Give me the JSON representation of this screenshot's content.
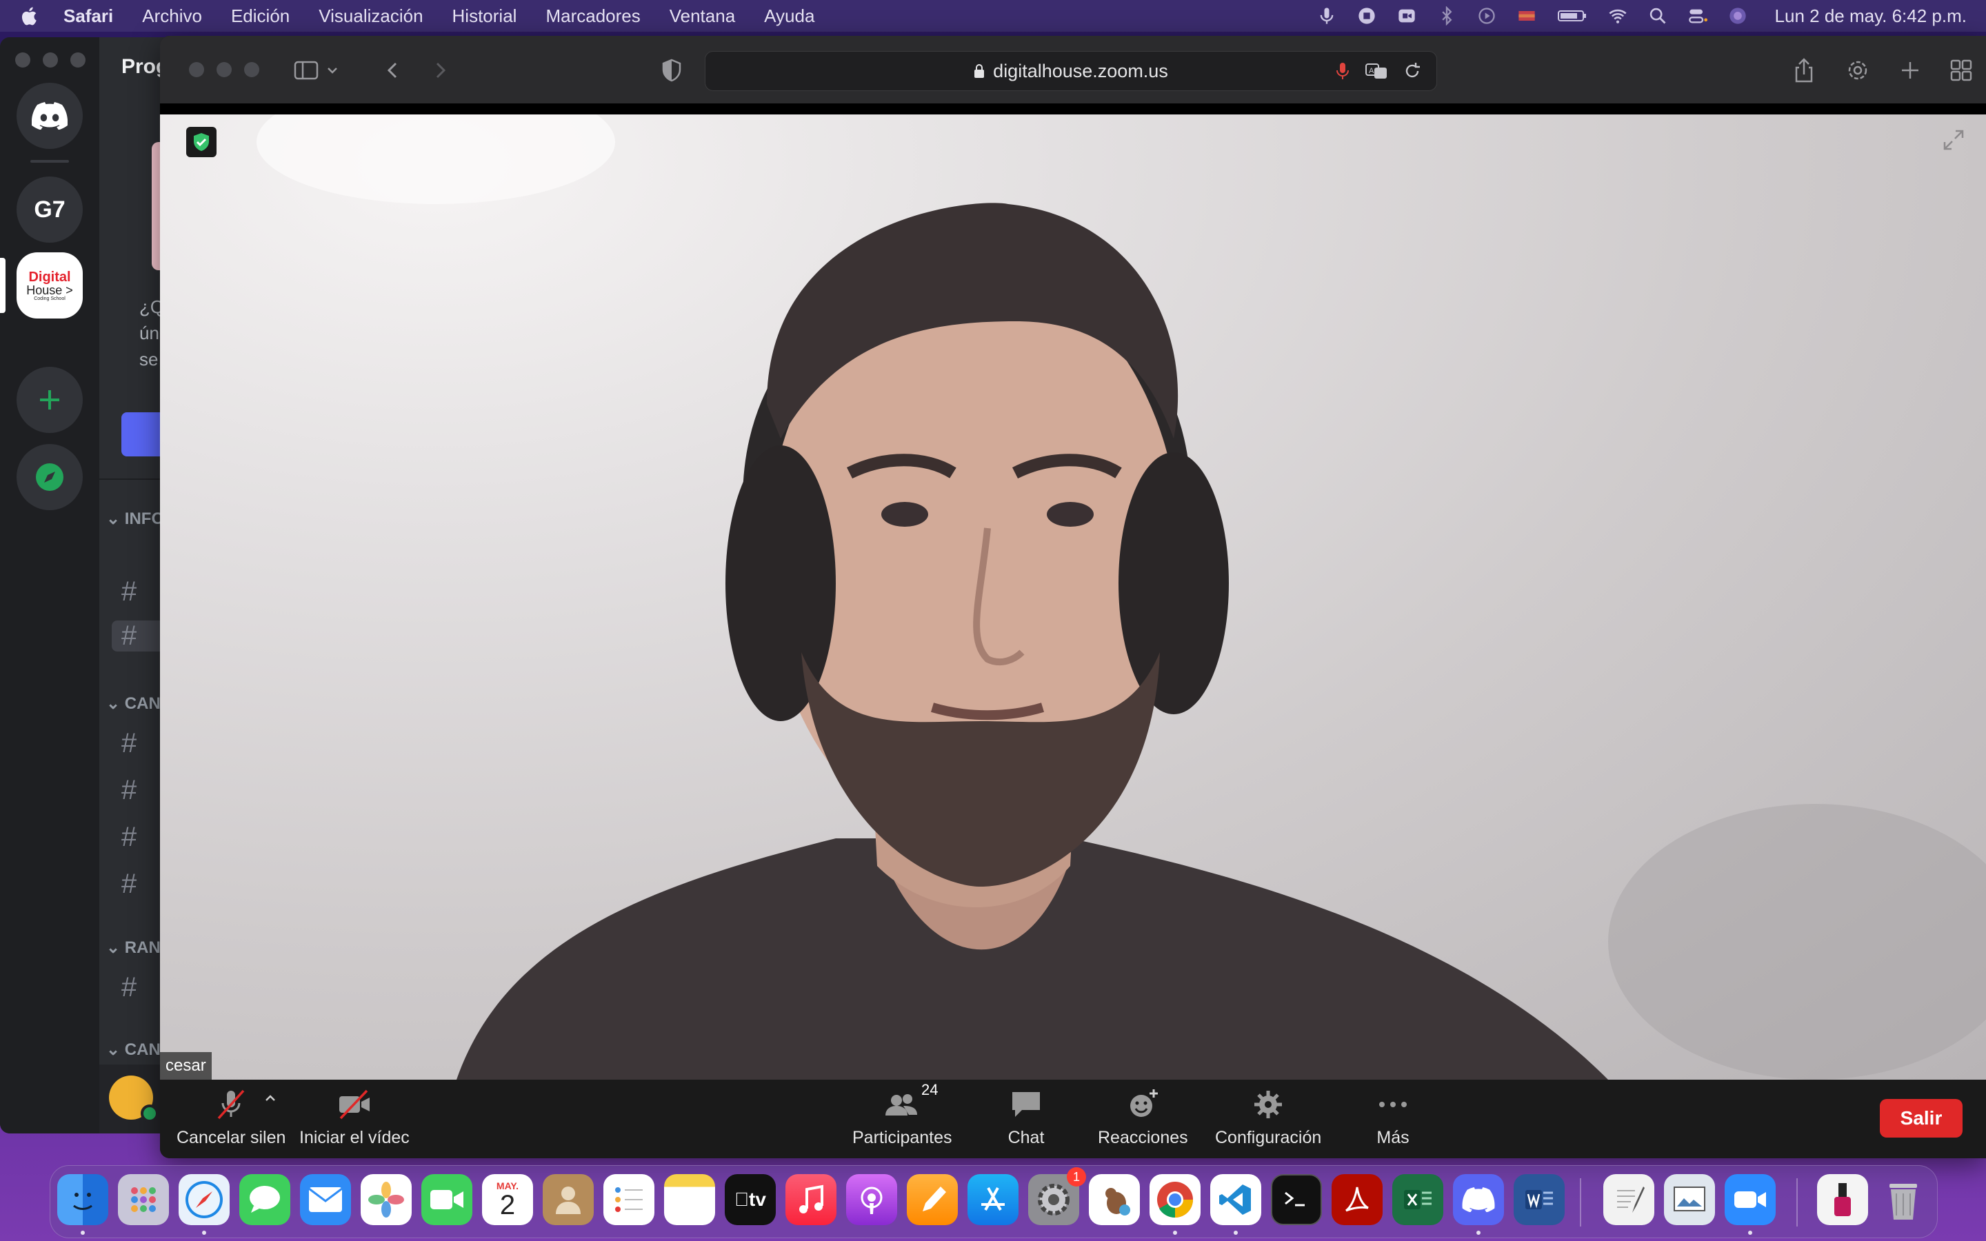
{
  "menubar": {
    "app_name": "Safari",
    "menus": [
      "Archivo",
      "Edición",
      "Visualización",
      "Historial",
      "Marcadores",
      "Ventana",
      "Ayuda"
    ],
    "clock": "Lun 2 de may.  6:42 p.m."
  },
  "discord": {
    "server_title": "Prog",
    "guild_g7": "G7",
    "guild_dh": {
      "line1": "Digital",
      "line2": "House >",
      "line3": "Coding School"
    },
    "promo_lines": [
      "¿Q",
      "ún",
      "se"
    ],
    "categories": [
      "INFO",
      "CANA",
      "RANI",
      "CANA"
    ],
    "channel_symbol": "#"
  },
  "safari": {
    "url": "digitalhouse.zoom.us"
  },
  "zoom": {
    "participant_name": "cesar",
    "controls": {
      "mute_label": "Cancelar silen",
      "video_label": "Iniciar el vídec",
      "participants_label": "Participantes",
      "participants_count": "24",
      "chat_label": "Chat",
      "reactions_label": "Reacciones",
      "settings_label": "Configuración",
      "more_label": "Más",
      "leave_label": "Salir"
    }
  },
  "dock": {
    "calendar_month": "MAY.",
    "calendar_day": "2",
    "tv_label": "tv",
    "settings_badge": "1",
    "colors": {
      "accent": "#5865f2",
      "leave": "#e02828"
    }
  }
}
